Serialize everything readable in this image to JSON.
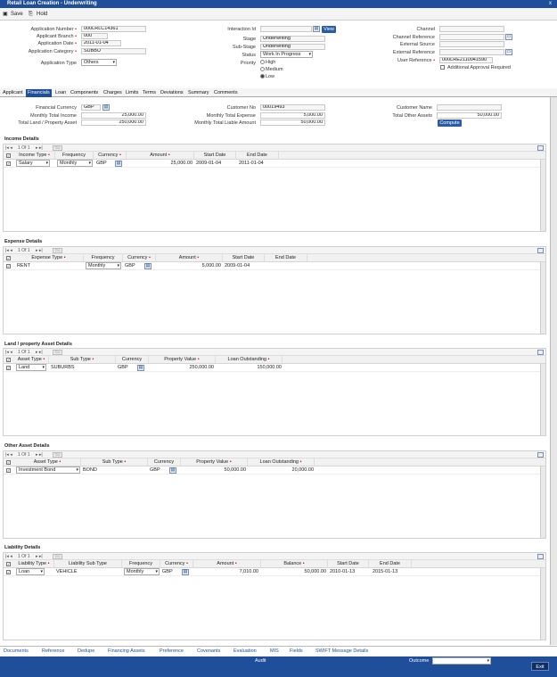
{
  "window": {
    "title": "Retail Loan Creation - Underwriting",
    "close": "x"
  },
  "toolbar": {
    "save": "Save",
    "hold": "Hold"
  },
  "header": {
    "application_number_label": "Application Number",
    "application_number": "000LRLC14361",
    "applicant_branch_label": "Applicant Branch",
    "applicant_branch": "000",
    "application_date_label": "Application Date",
    "application_date": "2011-01-04",
    "application_category_label": "Application Category",
    "application_category": "SUBBU",
    "application_type_label": "Application Type",
    "application_type": "Others",
    "interaction_id_label": "Interaction Id",
    "interaction_id": "",
    "view_button": "View",
    "stage_label": "Stage",
    "stage": "Underwriting",
    "sub_stage_label": "Sub-Stage",
    "sub_stage": "Underwriting",
    "status_label": "Status",
    "status": "Work In Progress",
    "priority_label": "Priority",
    "priority_options": [
      "High",
      "Medium",
      "Low"
    ],
    "priority_selected": "Low",
    "channel_label": "Channel",
    "channel": "",
    "channel_reference_label": "Channel Reference",
    "channel_reference": "",
    "external_source_label": "External Source",
    "external_source": "",
    "external_reference_label": "External Reference",
    "external_reference": "",
    "user_reference_label": "User Reference",
    "user_reference": "000LRE2110041590",
    "additional_approval_label": "Additional Approval Required"
  },
  "tabs": [
    "Applicant",
    "Financials",
    "Loan",
    "Components",
    "Charges",
    "Limits",
    "Terms",
    "Deviations",
    "Summary",
    "Comments"
  ],
  "active_tab": "Financials",
  "financials": {
    "financial_currency_label": "Financial Currency",
    "financial_currency": "GBP",
    "monthly_total_income_label": "Monthly Total Income",
    "monthly_total_income": "25,000.00",
    "total_land_label": "Total Land / Property Asset",
    "total_land": "250,000.00",
    "customer_no_label": "Customer No",
    "customer_no": "00019493",
    "monthly_total_expense_label": "Monthly Total Expense",
    "monthly_total_expense": "5,000.00",
    "monthly_total_liable_label": "Monthly Total Liable Amount",
    "monthly_total_liable": "50,000.00",
    "customer_name_label": "Customer Name",
    "customer_name": "",
    "total_other_assets_label": "Total Other Assets",
    "total_other_assets": "50,000.00",
    "compute_button": "Compute"
  },
  "pager": {
    "text": "1 Of 1",
    "go": "Go"
  },
  "income": {
    "title": "Income Details",
    "headers": [
      "Income Type",
      "Frequency",
      "Currency",
      "Amount",
      "Start Date",
      "End Date"
    ],
    "row": {
      "type": "Salary",
      "frequency": "Monthly",
      "currency": "GBP",
      "amount": "25,000.00",
      "start": "2009-01-04",
      "end": "2011-01-04"
    }
  },
  "expense": {
    "title": "Expense Details",
    "headers": [
      "Expense Type",
      "Frequency",
      "Currency",
      "Amount",
      "Start Date",
      "End Date"
    ],
    "row": {
      "type": "RENT",
      "frequency": "Monthly",
      "currency": "GBP",
      "amount": "5,000.00",
      "start": "2009-01-04",
      "end": ""
    }
  },
  "land": {
    "title": "Land / property Asset Details",
    "headers": [
      "Asset Type",
      "Sub Type",
      "Currency",
      "Property Value",
      "Loan Outstanding"
    ],
    "row": {
      "type": "Land",
      "subtype": "SUBURBS",
      "currency": "GBP",
      "value": "250,000.00",
      "outstanding": "150,000.00"
    }
  },
  "other": {
    "title": "Other Asset Details",
    "headers": [
      "Asset Type",
      "Sub Type",
      "Currency",
      "Property Value",
      "Loan Outstanding"
    ],
    "row": {
      "type": "Investment Bond",
      "subtype": "BOND",
      "currency": "GBP",
      "value": "50,000.00",
      "outstanding": "20,000.00"
    }
  },
  "liability": {
    "title": "Liability Details",
    "headers": [
      "Liability Type",
      "Liability Sub Type",
      "Frequency",
      "Currency",
      "Amount",
      "Balance",
      "Start Date",
      "End Date"
    ],
    "row": {
      "type": "Loan",
      "subtype": "VEHICLE",
      "frequency": "Monthly",
      "currency": "GBP",
      "amount": "7,010.00",
      "balance": "50,000.00",
      "start": "2010-01-13",
      "end": "2015-01-13"
    }
  },
  "footer_links": [
    "Documents",
    "Reference",
    "Dedupe",
    "Financing Assets",
    "Preference",
    "Covenants",
    "Evaluation",
    "MIS",
    "Fields",
    "SWIFT Message Details"
  ],
  "bottom": {
    "audit": "Audit",
    "outcome_label": "Outcome",
    "outcome": "",
    "exit": "Exit"
  }
}
